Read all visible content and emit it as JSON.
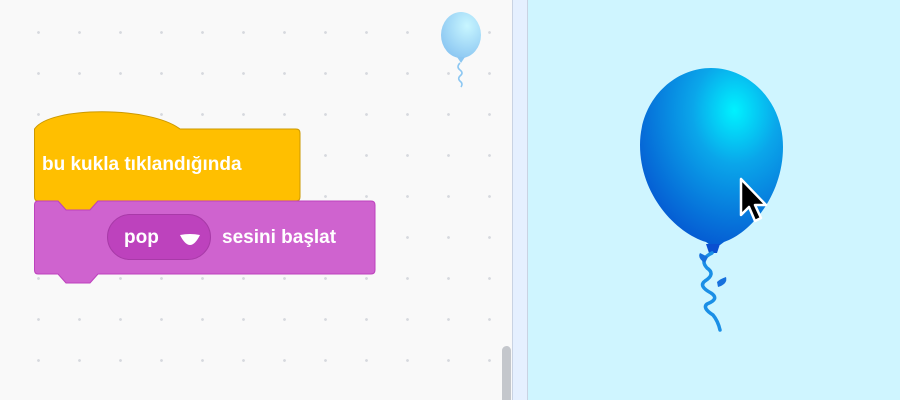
{
  "workspace": {
    "sprite_icon": "balloon-icon",
    "blocks": {
      "event": {
        "label": "bu kukla tıklandığında",
        "color": "#ffbf00",
        "stroke": "#cc9900"
      },
      "sound": {
        "menu_value": "pop",
        "label": "sesini başlat",
        "color": "#cf63cf",
        "stroke": "#bd42bd",
        "menu_color": "#bd42bd"
      }
    }
  },
  "stage": {
    "background": "#cff5ff",
    "sprite": "balloon-sprite",
    "cursor_icon": "mouse-pointer-icon"
  }
}
